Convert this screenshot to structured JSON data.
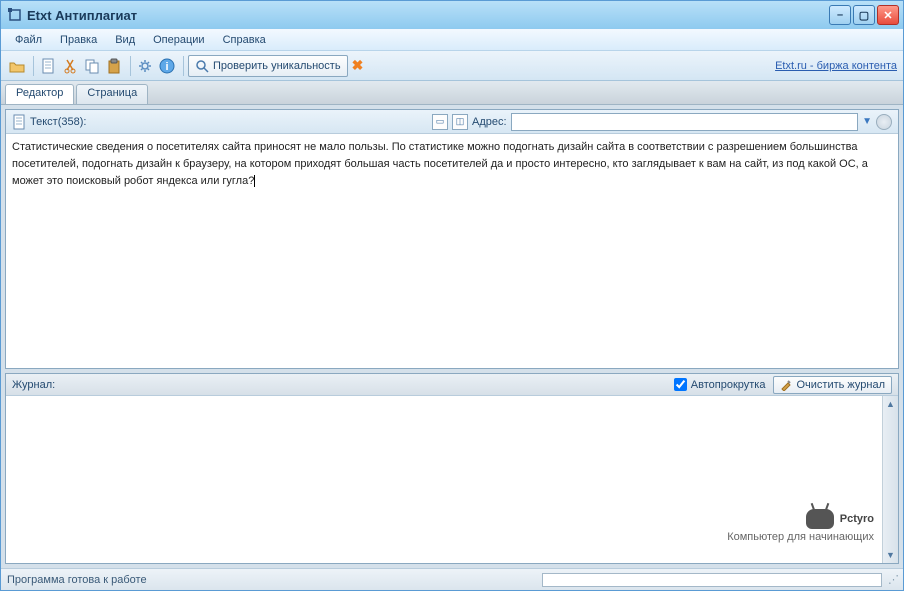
{
  "window": {
    "title": "Etxt Антиплагиат"
  },
  "menu": {
    "file": "Файл",
    "edit": "Правка",
    "view": "Вид",
    "ops": "Операции",
    "help": "Справка"
  },
  "toolbar": {
    "check_button": "Проверить уникальность",
    "link": "Etxt.ru - биржа контента"
  },
  "tabs": {
    "editor": "Редактор",
    "page": "Страница"
  },
  "doc": {
    "text_label": "Текст(358):",
    "address_label": "Адрес:",
    "address_value": "",
    "body": "Статистические сведения о посетителях сайта приносят не мало пользы. По статистике можно подогнать дизайн сайта в соответствии с разрешением большинства посетителей, подогнать дизайн к браузеру, на котором приходят большая часть посетителей да и просто интересно, кто заглядывает к вам на сайт, из под какой ОС, а может это поисковый робот яндекса или гугла?"
  },
  "log": {
    "label": "Журнал:",
    "autoscroll": "Автопрокрутка",
    "clear": "Очистить журнал"
  },
  "watermark": {
    "brand": "Pctyro",
    "sub": "Компьютер для начинающих"
  },
  "status": {
    "text": "Программа готова к работе"
  }
}
